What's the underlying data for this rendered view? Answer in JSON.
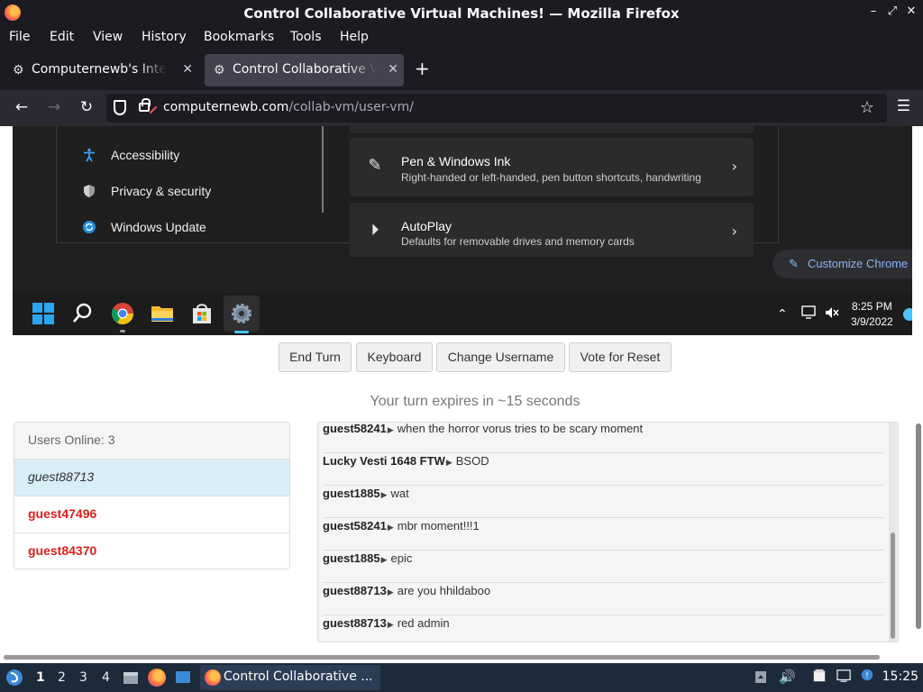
{
  "window": {
    "title": "Control Collaborative Virtual Machines! — Mozilla Firefox",
    "minimize": "–",
    "maximize": "⤢",
    "close": "✕"
  },
  "menu": [
    "File",
    "Edit",
    "View",
    "History",
    "Bookmarks",
    "Tools",
    "Help"
  ],
  "tabs": [
    {
      "label": "Computernewb's Internet",
      "active": false
    },
    {
      "label": "Control Collaborative Virtual Machines!",
      "active": true
    }
  ],
  "nav": {
    "back": "←",
    "forward": "→",
    "reload": "↻",
    "url_host": "computernewb.com",
    "url_path": "/collab-vm/user-vm/",
    "new_tab": "+",
    "bookmark": "☆",
    "menu": "☰"
  },
  "vm": {
    "sidebar": [
      {
        "label": "Accessibility",
        "icon": "accessibility-icon"
      },
      {
        "label": "Privacy & security",
        "icon": "shield-icon"
      },
      {
        "label": "Windows Update",
        "icon": "update-icon"
      }
    ],
    "cards": [
      {
        "title": "Pen & Windows Ink",
        "subtitle": "Right-handed or left-handed, pen button shortcuts, handwriting",
        "icon": "pen-icon"
      },
      {
        "title": "AutoPlay",
        "subtitle": "Defaults for removable drives and memory cards",
        "icon": "autoplay-icon"
      }
    ],
    "customize_label": "Customize Chrome",
    "clock_time": "8:25 PM",
    "clock_date": "3/9/2022"
  },
  "controls": {
    "end_turn": "End Turn",
    "keyboard": "Keyboard",
    "change_username": "Change Username",
    "vote_reset": "Vote for Reset",
    "turn_message": "Your turn expires in ~15 seconds"
  },
  "users": {
    "header": "Users Online: 3",
    "list": [
      {
        "name": "guest88713",
        "type": "self"
      },
      {
        "name": "guest47496",
        "type": "admin"
      },
      {
        "name": "guest84370",
        "type": "admin"
      }
    ]
  },
  "chat": [
    {
      "user": "guest58241",
      "text": "when the horror vorus tries to be scary moment"
    },
    {
      "user": "Lucky Vesti 1648 FTW",
      "text": "BSOD"
    },
    {
      "user": "guest1885",
      "text": "wat"
    },
    {
      "user": "guest58241",
      "text": "mbr moment!!!1"
    },
    {
      "user": "guest1885",
      "text": "epic"
    },
    {
      "user": "guest88713",
      "text": "are you hhildaboo"
    },
    {
      "user": "guest88713",
      "text": "red admin"
    }
  ],
  "os": {
    "workspaces": [
      "1",
      "2",
      "3",
      "4"
    ],
    "window_label": "Control Collaborative ...",
    "time": "15:25"
  }
}
